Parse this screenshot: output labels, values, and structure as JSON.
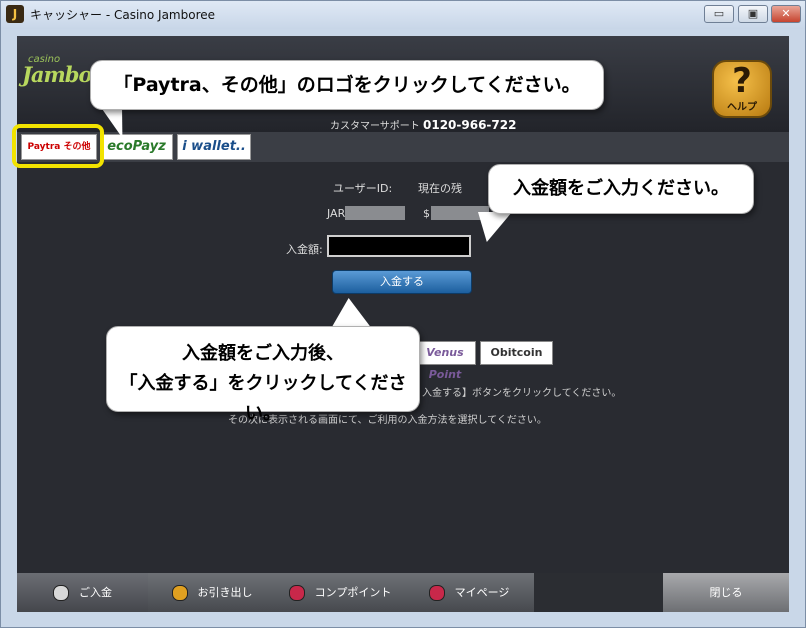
{
  "window": {
    "title": "キャッシャー - Casino Jamboree",
    "icon": "casino-chip-icon",
    "controls": {
      "minimize": "▭",
      "maximize": "▣",
      "close": "✕"
    }
  },
  "header": {
    "logo_small": "casino",
    "logo_main": "Jambo",
    "support_label": "カスタマーサポート",
    "support_phone": "0120-966-722",
    "help_symbol": "?",
    "help_label": "ヘルプ"
  },
  "payment_tabs": [
    {
      "label": "Paytra その他",
      "selected": true
    },
    {
      "label": "ecoPayz",
      "selected": false
    },
    {
      "label": "i wallet..",
      "selected": false
    }
  ],
  "form": {
    "user_id_label": "ユーザーID:",
    "user_id_value": "JAR",
    "balance_label": "現在の残",
    "balance_value": "$",
    "amount_label": "入金額:",
    "amount_value": "",
    "submit_label": "入金する"
  },
  "payment_methods": [
    {
      "label": "Venus Point"
    },
    {
      "label": "Obitcoin"
    }
  ],
  "instructions": {
    "line1": "入金する】ボタンをクリックしてください。",
    "line2": "その次に表示される画面にて、ご利用の入金方法を選択してください。"
  },
  "nav": {
    "deposit": "ご入金",
    "withdraw": "お引き出し",
    "comp_points": "コンプポイント",
    "my_page": "マイページ",
    "close": "閉じる"
  },
  "callouts": {
    "logo_hint": "「Paytra、その他」のロゴをクリックしてください。",
    "amount_hint": "入金額をご入力ください。",
    "submit_hint_1": "入金額をご入力後、",
    "submit_hint_2": "「入金する」をクリックしてください。"
  },
  "colors": {
    "app_background": "#292b31",
    "highlight": "#f2e300",
    "primary_button": "#1c5f9e",
    "logo_green": "#b8d85e"
  }
}
